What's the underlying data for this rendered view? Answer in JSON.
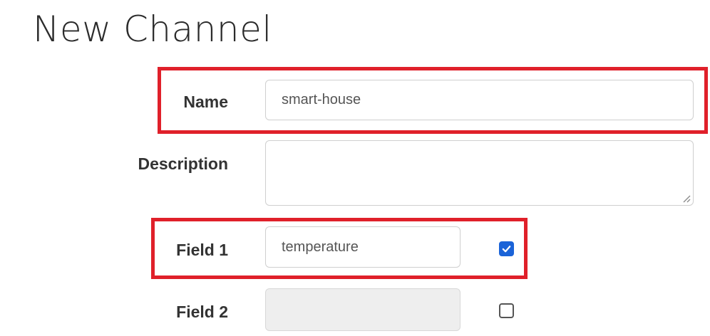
{
  "page": {
    "title": "New Channel"
  },
  "form": {
    "name": {
      "label": "Name",
      "value": "smart-house"
    },
    "description": {
      "label": "Description",
      "value": ""
    },
    "fields": [
      {
        "label": "Field 1",
        "value": "temperature",
        "checked": true,
        "enabled": true
      },
      {
        "label": "Field 2",
        "value": "",
        "checked": false,
        "enabled": false
      }
    ]
  },
  "colors": {
    "highlight": "#e0202a",
    "checkbox_checked": "#1a63d8"
  }
}
